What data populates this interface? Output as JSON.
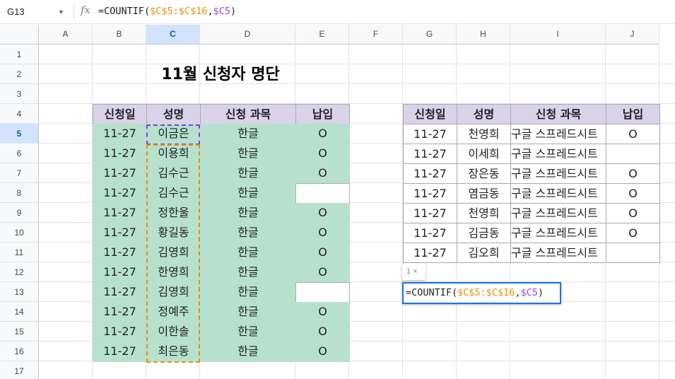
{
  "name_box": "G13",
  "formula_bar": {
    "fx_icon": "function-icon",
    "prefix": "=COUNTIF(",
    "range": "$C$5:$C$16",
    "comma": ",",
    "criterion": "$C5",
    "suffix": ")"
  },
  "columns": [
    "A",
    "B",
    "C",
    "D",
    "E",
    "F",
    "G",
    "H",
    "I",
    "J"
  ],
  "rows": [
    "1",
    "2",
    "3",
    "4",
    "5",
    "6",
    "7",
    "8",
    "9",
    "10",
    "11",
    "12",
    "13",
    "14",
    "15",
    "16",
    "17"
  ],
  "title": "11월 신청자 명단",
  "left_table": {
    "headers": [
      "신청일",
      "성명",
      "신청 과목",
      "납입"
    ],
    "rows": [
      [
        "11-27",
        "이금은",
        "한글",
        "O"
      ],
      [
        "11-27",
        "이용희",
        "한글",
        "O"
      ],
      [
        "11-27",
        "김수근",
        "한글",
        "O"
      ],
      [
        "11-27",
        "김수근",
        "한글",
        ""
      ],
      [
        "11-27",
        "정한울",
        "한글",
        "O"
      ],
      [
        "11-27",
        "황길동",
        "한글",
        "O"
      ],
      [
        "11-27",
        "김영희",
        "한글",
        "O"
      ],
      [
        "11-27",
        "한영희",
        "한글",
        "O"
      ],
      [
        "11-27",
        "김영희",
        "한글",
        ""
      ],
      [
        "11-27",
        "정예주",
        "한글",
        "O"
      ],
      [
        "11-27",
        "이한솔",
        "한글",
        "O"
      ],
      [
        "11-27",
        "최은동",
        "한글",
        "O"
      ]
    ]
  },
  "right_table": {
    "headers": [
      "신청일",
      "성명",
      "신청 과목",
      "납입"
    ],
    "rows": [
      [
        "11-27",
        "천영희",
        "구글 스프레드시트",
        "O"
      ],
      [
        "11-27",
        "이세희",
        "구글 스프레드시트",
        ""
      ],
      [
        "11-27",
        "장은동",
        "구글 스프레드시트",
        "O"
      ],
      [
        "11-27",
        "염금동",
        "구글 스프레드시트",
        "O"
      ],
      [
        "11-27",
        "천영희",
        "구글 스프레드시트",
        "O"
      ],
      [
        "11-27",
        "김금동",
        "구글 스프레드시트",
        "O"
      ],
      [
        "11-27",
        "김오희",
        "구글 스프레드시트",
        ""
      ]
    ]
  },
  "editor": {
    "hint": "1",
    "hint_close": "×",
    "prefix": "=COUNTIF(",
    "range": "$C$5:$C$16",
    "comma": ",",
    "criterion": "$C5",
    "suffix": ")"
  },
  "colors": {
    "header_fill": "#d9d2e9",
    "data_fill": "#b7e1cd",
    "selection": "#1a73e8",
    "range_ref": "#e8900c",
    "criterion_ref": "#a142f4"
  }
}
